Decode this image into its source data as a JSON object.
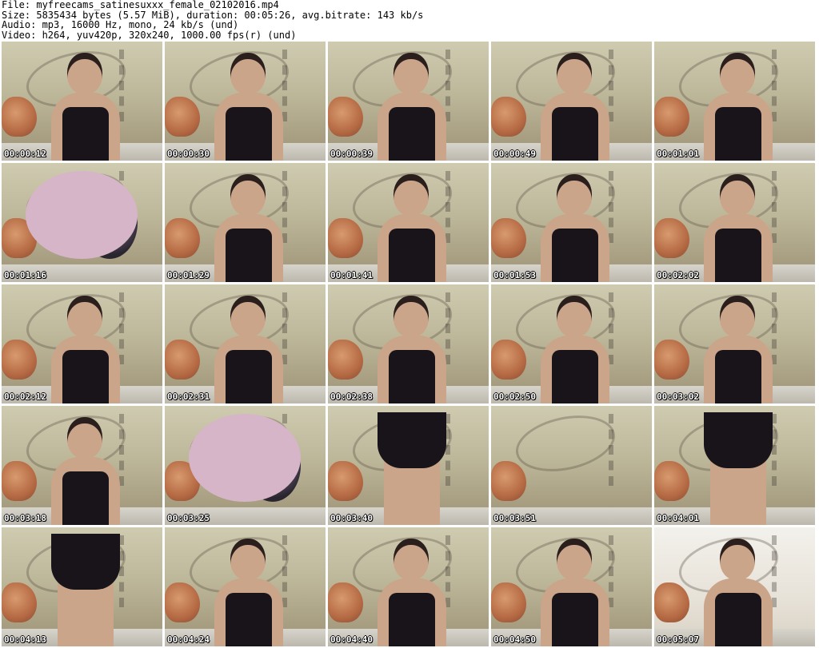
{
  "header": {
    "file": "File: myfreecams_satinesuxxx_female_02102016.mp4",
    "size": "Size: 5835434 bytes (5.57 MiB), duration: 00:05:26, avg.bitrate: 143 kb/s",
    "audio": "Audio: mp3, 16000 Hz, mono, 24 kb/s (und)",
    "video": "Video: h264, yuv420p, 320x240, 1000.00 fps(r) (und)"
  },
  "thumbnails": [
    {
      "timestamp": "00:00:12",
      "variant": "normal"
    },
    {
      "timestamp": "00:00:30",
      "variant": "normal"
    },
    {
      "timestamp": "00:00:39",
      "variant": "normal"
    },
    {
      "timestamp": "00:00:49",
      "variant": "normal"
    },
    {
      "timestamp": "00:01:01",
      "variant": "normal"
    },
    {
      "timestamp": "00:01:16",
      "variant": "close"
    },
    {
      "timestamp": "00:01:29",
      "variant": "normal"
    },
    {
      "timestamp": "00:01:41",
      "variant": "normal"
    },
    {
      "timestamp": "00:01:53",
      "variant": "normal"
    },
    {
      "timestamp": "00:02:02",
      "variant": "normal"
    },
    {
      "timestamp": "00:02:12",
      "variant": "normal"
    },
    {
      "timestamp": "00:02:31",
      "variant": "normal"
    },
    {
      "timestamp": "00:02:38",
      "variant": "normal"
    },
    {
      "timestamp": "00:02:50",
      "variant": "normal"
    },
    {
      "timestamp": "00:03:02",
      "variant": "normal"
    },
    {
      "timestamp": "00:03:18",
      "variant": "normal"
    },
    {
      "timestamp": "00:03:25",
      "variant": "close"
    },
    {
      "timestamp": "00:03:40",
      "variant": "legs"
    },
    {
      "timestamp": "00:03:51",
      "variant": "empty"
    },
    {
      "timestamp": "00:04:01",
      "variant": "legs"
    },
    {
      "timestamp": "00:04:13",
      "variant": "legs"
    },
    {
      "timestamp": "00:04:24",
      "variant": "normal"
    },
    {
      "timestamp": "00:04:40",
      "variant": "normal"
    },
    {
      "timestamp": "00:04:50",
      "variant": "normal"
    },
    {
      "timestamp": "00:05:07",
      "variant": "bright"
    }
  ]
}
